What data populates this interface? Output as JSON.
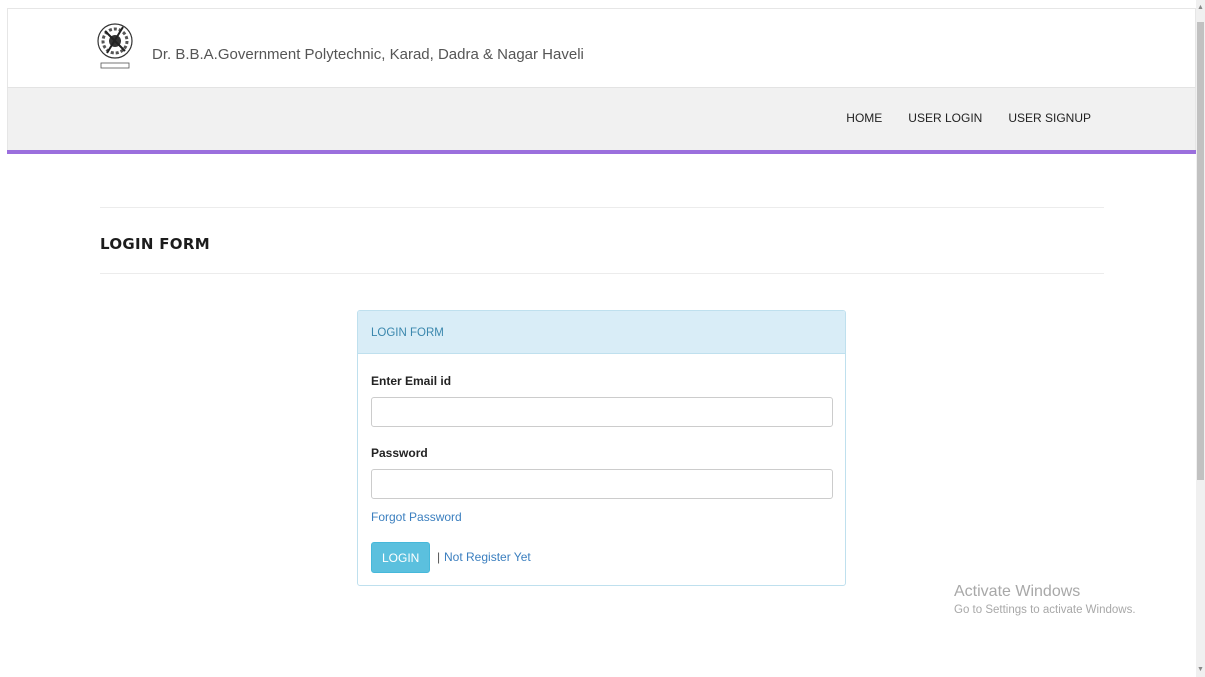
{
  "header": {
    "site_title": "Dr. B.B.A.Government Polytechnic, Karad, Dadra & Nagar Haveli",
    "logo_icon": "college-emblem-logo"
  },
  "nav": {
    "items": [
      {
        "label": "HOME"
      },
      {
        "label": "USER LOGIN"
      },
      {
        "label": "USER SIGNUP"
      }
    ],
    "accent_color": "#9b6fdd"
  },
  "page": {
    "heading": "LOGIN FORM"
  },
  "login_panel": {
    "title": "LOGIN FORM",
    "email_label": "Enter Email id",
    "email_value": "",
    "password_label": "Password",
    "password_value": "",
    "forgot_link": "Forgot Password",
    "login_button": "LOGIN",
    "separator": "|",
    "register_link": "Not Register Yet",
    "header_color": "#d9edf7",
    "button_color": "#5bc0de"
  },
  "watermark": {
    "title": "Activate Windows",
    "subtitle": "Go to Settings to activate Windows."
  }
}
